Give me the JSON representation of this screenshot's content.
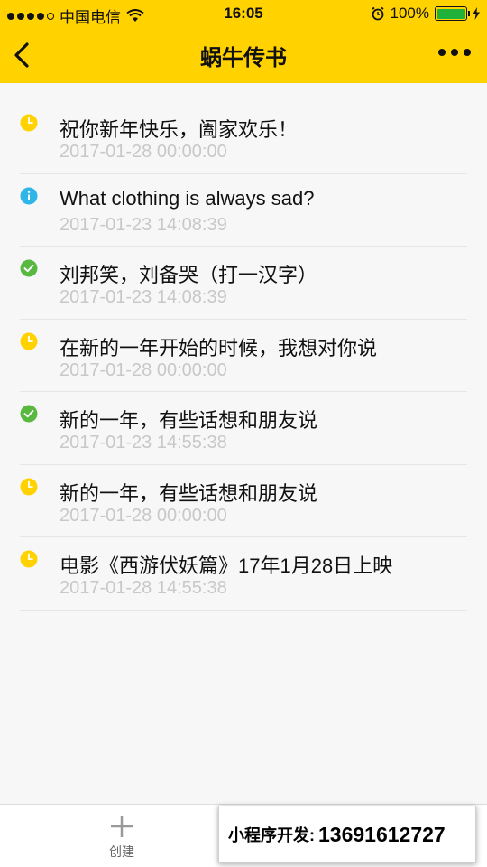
{
  "statusbar": {
    "carrier": "中国电信",
    "time": "16:05",
    "battery": "100%",
    "battery_level": 1.0
  },
  "nav": {
    "title": "蜗牛传书",
    "back_icon": "chevron-left-icon",
    "more_icon": "more-dots-icon"
  },
  "items": [
    {
      "title": "祝你新年快乐，阖家欢乐！",
      "time": "2017-01-28 00:00:00",
      "status": "pending",
      "icon": "clock-icon",
      "color": "#ffd200"
    },
    {
      "title": "What clothing is always sad?",
      "time": "2017-01-23 14:08:39",
      "status": "info",
      "icon": "info-icon",
      "color": "#2fb6e8"
    },
    {
      "title": "刘邦笑，刘备哭（打一汉字）",
      "time": "2017-01-23 14:08:39",
      "status": "done",
      "icon": "check-icon",
      "color": "#58b83f"
    },
    {
      "title": "在新的一年开始的时候，我想对你说",
      "time": "2017-01-28 00:00:00",
      "status": "pending",
      "icon": "clock-icon",
      "color": "#ffd200"
    },
    {
      "title": "新的一年，有些话想和朋友说",
      "time": "2017-01-23 14:55:38",
      "status": "done",
      "icon": "check-icon",
      "color": "#58b83f"
    },
    {
      "title": "新的一年，有些话想和朋友说",
      "time": "2017-01-28 00:00:00",
      "status": "pending",
      "icon": "clock-icon",
      "color": "#ffd200"
    },
    {
      "title": "电影《西游伏妖篇》17年1月28日上映",
      "time": "2017-01-28 14:55:38",
      "status": "pending",
      "icon": "clock-icon",
      "color": "#ffd200"
    }
  ],
  "tabbar": {
    "create_label": "创建",
    "create_icon": "plus-icon"
  },
  "promo": {
    "label": "小程序开发:",
    "phone": "13691612727"
  },
  "colors": {
    "brand": "#ffd200",
    "pending": "#ffd200",
    "info": "#2fb6e8",
    "done": "#58b83f"
  }
}
